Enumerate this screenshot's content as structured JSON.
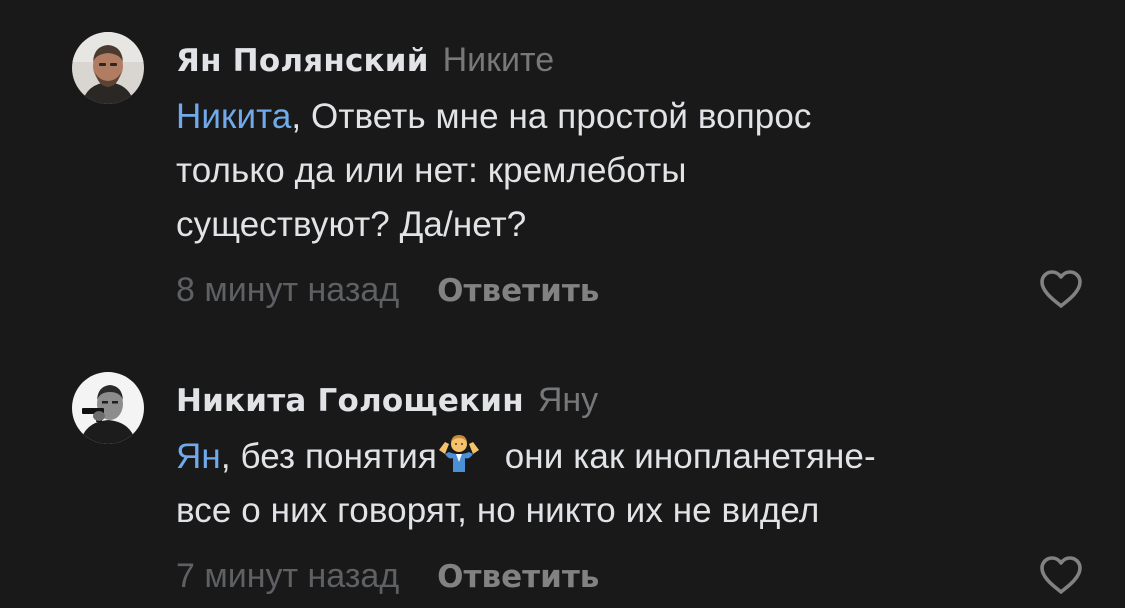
{
  "comments": [
    {
      "author": "Ян Полянский",
      "reply_to": "Никите",
      "mention": "Никита",
      "text_lines": [
        ", Ответь мне на простой вопрос",
        "только да или нет: кремлеботы",
        "существуют? Да/нет?"
      ],
      "time": "8 минут назад",
      "reply_label": "Ответить",
      "avatar_icon": "avatar-man-beard",
      "like_icon": "heart-outline-icon"
    },
    {
      "author": "Никита Голощекин",
      "reply_to": "Яну",
      "mention": "Ян",
      "text_lines": [
        ", без понятия",
        " они как инопланетяне-",
        "все о них говорят, но никто их не видел"
      ],
      "emoji_icon": "man-shrugging-emoji",
      "time": "7 минут назад",
      "reply_label": "Ответить",
      "avatar_icon": "avatar-man-with-gun",
      "like_icon": "heart-outline-icon"
    }
  ],
  "colors": {
    "background": "#19191a",
    "text": "#e1e3e6",
    "secondary": "#76787a",
    "mention": "#71aaeb",
    "action": "#828282"
  }
}
